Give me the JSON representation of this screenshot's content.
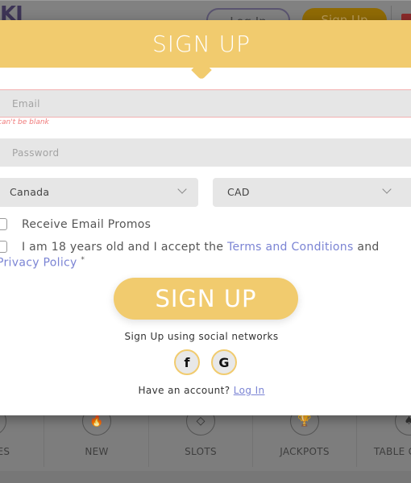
{
  "background": {
    "logo_text": "KI",
    "login_label": "Log In",
    "signup_label": "Sign Up",
    "nav": [
      {
        "label": "GAMES",
        "icon": "games-icon",
        "glyph": ""
      },
      {
        "label": "NEW",
        "icon": "fire-icon",
        "glyph": "🔥"
      },
      {
        "label": "SLOTS",
        "icon": "diamond-icon",
        "glyph": "◇"
      },
      {
        "label": "JACKPOTS",
        "icon": "trophy-icon",
        "glyph": "🏆"
      },
      {
        "label": "TABLE GAMES",
        "icon": "spade-icon",
        "glyph": "♠"
      }
    ]
  },
  "modal": {
    "title": "SIGN UP",
    "email": {
      "placeholder": "Email",
      "value": "",
      "error": "can't be blank"
    },
    "password": {
      "placeholder": "Password",
      "value": ""
    },
    "country": {
      "selected": "Canada"
    },
    "currency": {
      "selected": "CAD"
    },
    "promos": {
      "label": "Receive Email Promos",
      "checked": false
    },
    "terms": {
      "prefix": "I am 18 years old and I accept the ",
      "terms_link": "Terms and Conditions",
      "middle": " and",
      "privacy_link": "Privacy Policy",
      "required_mark": "*",
      "checked": false
    },
    "submit_label": "SIGN UP",
    "social_text": "Sign Up using social networks",
    "social": [
      {
        "name": "facebook",
        "glyph": "f"
      },
      {
        "name": "google",
        "glyph": "G"
      }
    ],
    "have_account_text": "Have an account? ",
    "login_link": "Log In"
  },
  "colors": {
    "accent": "#f1cb6e",
    "link": "#7b84d4",
    "error": "#f07a7a",
    "field_bg": "#e6e6e6"
  }
}
